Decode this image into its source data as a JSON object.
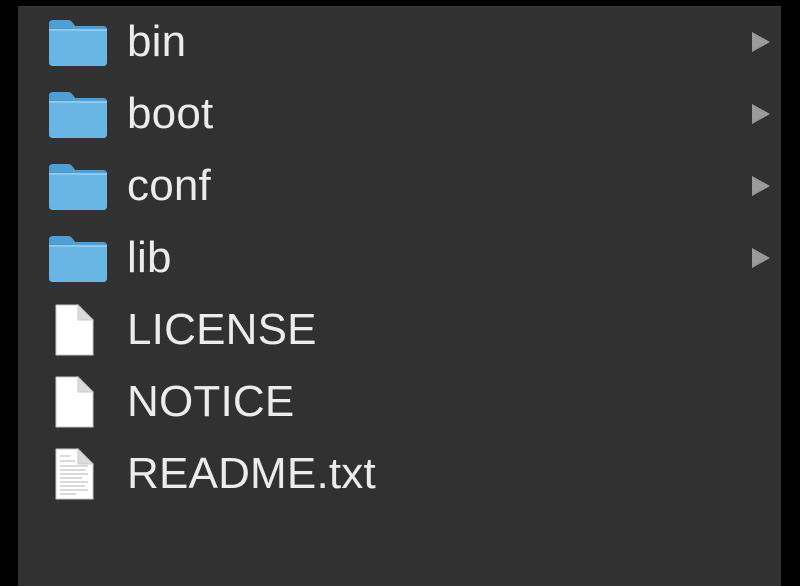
{
  "colors": {
    "background": "#313131",
    "text": "#ececec",
    "folder": "#69b6e4",
    "disclosure": "#9a9a9a"
  },
  "items": [
    {
      "name": "bin",
      "kind": "folder",
      "icon": "folder-icon",
      "expandable": true
    },
    {
      "name": "boot",
      "kind": "folder",
      "icon": "folder-icon",
      "expandable": true
    },
    {
      "name": "conf",
      "kind": "folder",
      "icon": "folder-icon",
      "expandable": true
    },
    {
      "name": "lib",
      "kind": "folder",
      "icon": "folder-icon",
      "expandable": true
    },
    {
      "name": "LICENSE",
      "kind": "file",
      "icon": "document-icon",
      "expandable": false
    },
    {
      "name": "NOTICE",
      "kind": "file",
      "icon": "document-icon",
      "expandable": false
    },
    {
      "name": "README.txt",
      "kind": "file",
      "icon": "text-document-icon",
      "expandable": false
    }
  ]
}
